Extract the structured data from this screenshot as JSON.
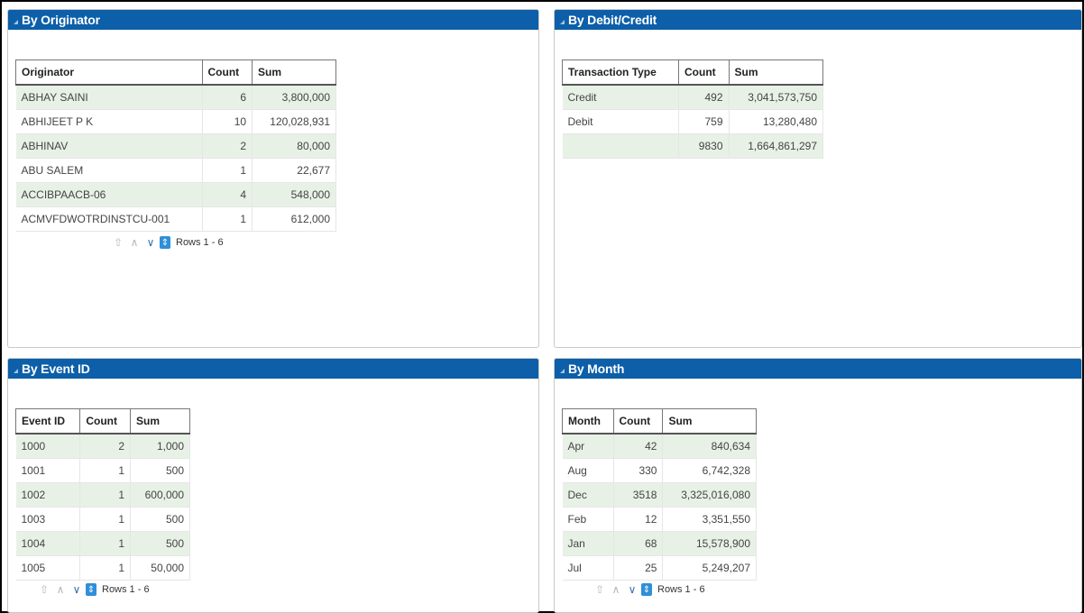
{
  "panels": {
    "originator": {
      "title": "By Originator",
      "headers": [
        "Originator",
        "Count",
        "Sum"
      ],
      "rows": [
        [
          "ABHAY SAINI",
          "6",
          "3,800,000"
        ],
        [
          "ABHIJEET P K",
          "10",
          "120,028,931"
        ],
        [
          "ABHINAV",
          "2",
          "80,000"
        ],
        [
          "ABU SALEM",
          "1",
          "22,677"
        ],
        [
          "ACCIBPAACB-06",
          "4",
          "548,000"
        ],
        [
          "ACMVFDWOTRDINSTCU-001",
          "1",
          "612,000"
        ]
      ],
      "pager": "Rows 1 - 6"
    },
    "debit_credit": {
      "title": "By Debit/Credit",
      "headers": [
        "Transaction Type",
        "Count",
        "Sum"
      ],
      "rows": [
        [
          "Credit",
          "492",
          "3,041,573,750"
        ],
        [
          "Debit",
          "759",
          "13,280,480"
        ],
        [
          "",
          "9830",
          "1,664,861,297"
        ]
      ]
    },
    "event": {
      "title": "By Event ID",
      "headers": [
        "Event ID",
        "Count",
        "Sum"
      ],
      "rows": [
        [
          "1000",
          "2",
          "1,000"
        ],
        [
          "1001",
          "1",
          "500"
        ],
        [
          "1002",
          "1",
          "600,000"
        ],
        [
          "1003",
          "1",
          "500"
        ],
        [
          "1004",
          "1",
          "500"
        ],
        [
          "1005",
          "1",
          "50,000"
        ]
      ],
      "pager": "Rows 1 - 6"
    },
    "month": {
      "title": "By Month",
      "headers": [
        "Month",
        "Count",
        "Sum"
      ],
      "rows": [
        [
          "Apr",
          "42",
          "840,634"
        ],
        [
          "Aug",
          "330",
          "6,742,328"
        ],
        [
          "Dec",
          "3518",
          "3,325,016,080"
        ],
        [
          "Feb",
          "12",
          "3,351,550"
        ],
        [
          "Jan",
          "68",
          "15,578,900"
        ],
        [
          "Jul",
          "25",
          "5,249,207"
        ]
      ],
      "pager": "Rows 1 - 6"
    }
  },
  "pager_icons": [
    "first-page-icon",
    "previous-page-icon",
    "next-page-icon",
    "all-rows-icon"
  ],
  "colors": {
    "header_bar": "#0c5fa8",
    "alt_row": "#e8f1e6"
  }
}
